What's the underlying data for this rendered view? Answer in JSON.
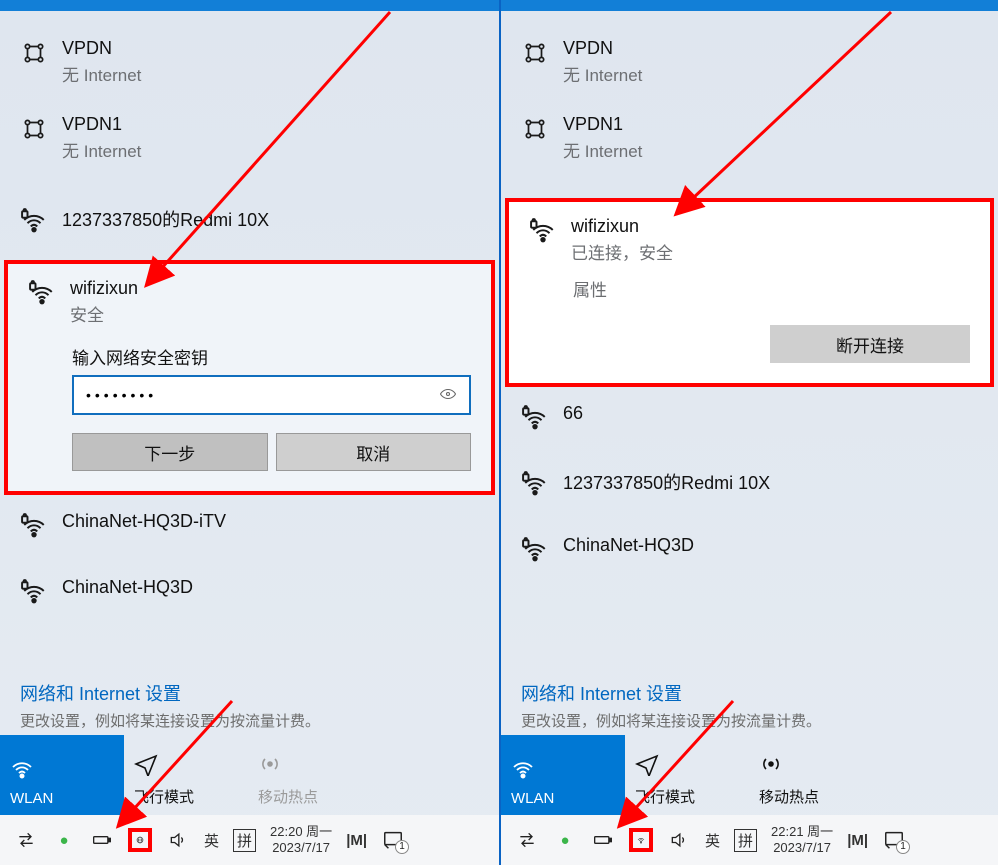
{
  "left": {
    "items": [
      {
        "name": "VPDN",
        "sub": "无 Internet",
        "icon": "computers"
      },
      {
        "name": "VPDN1",
        "sub": "无 Internet",
        "icon": "computers"
      },
      {
        "name": "1237337850的Redmi 10X",
        "sub": "",
        "icon": "wifisec"
      }
    ],
    "selected": {
      "name": "wifizixun",
      "sub": "安全",
      "prompt": "输入网络安全密钥",
      "password": "••••••••",
      "next": "下一步",
      "cancel": "取消"
    },
    "after": [
      {
        "name": "ChinaNet-HQ3D-iTV",
        "icon": "wifisec"
      },
      {
        "name": "ChinaNet-HQ3D",
        "icon": "wifisec"
      }
    ]
  },
  "right": {
    "items": [
      {
        "name": "VPDN",
        "sub": "无 Internet",
        "icon": "computers"
      },
      {
        "name": "VPDN1",
        "sub": "无 Internet",
        "icon": "computers"
      }
    ],
    "selected": {
      "name": "wifizixun",
      "sub": "已连接，安全",
      "props": "属性",
      "disconnect": "断开连接"
    },
    "after": [
      {
        "name": "66",
        "icon": "wifisec"
      },
      {
        "name": "1237337850的Redmi 10X",
        "icon": "wifisec"
      },
      {
        "name": "ChinaNet-HQ3D",
        "icon": "wifisec"
      }
    ]
  },
  "settings": {
    "title": "网络和 Internet 设置",
    "sub": "更改设置，例如将某连接设置为按流量计费。"
  },
  "tiles": {
    "wlan": "WLAN",
    "airplane": "飞行模式",
    "hotspot": "移动热点"
  },
  "taskbar": {
    "ime1": "英",
    "ime2": "拼",
    "left_time1": "22:20 周一",
    "left_time2": "2023/7/17",
    "right_time1": "22:21 周一",
    "right_time2": "2023/7/17",
    "badge": "1"
  }
}
